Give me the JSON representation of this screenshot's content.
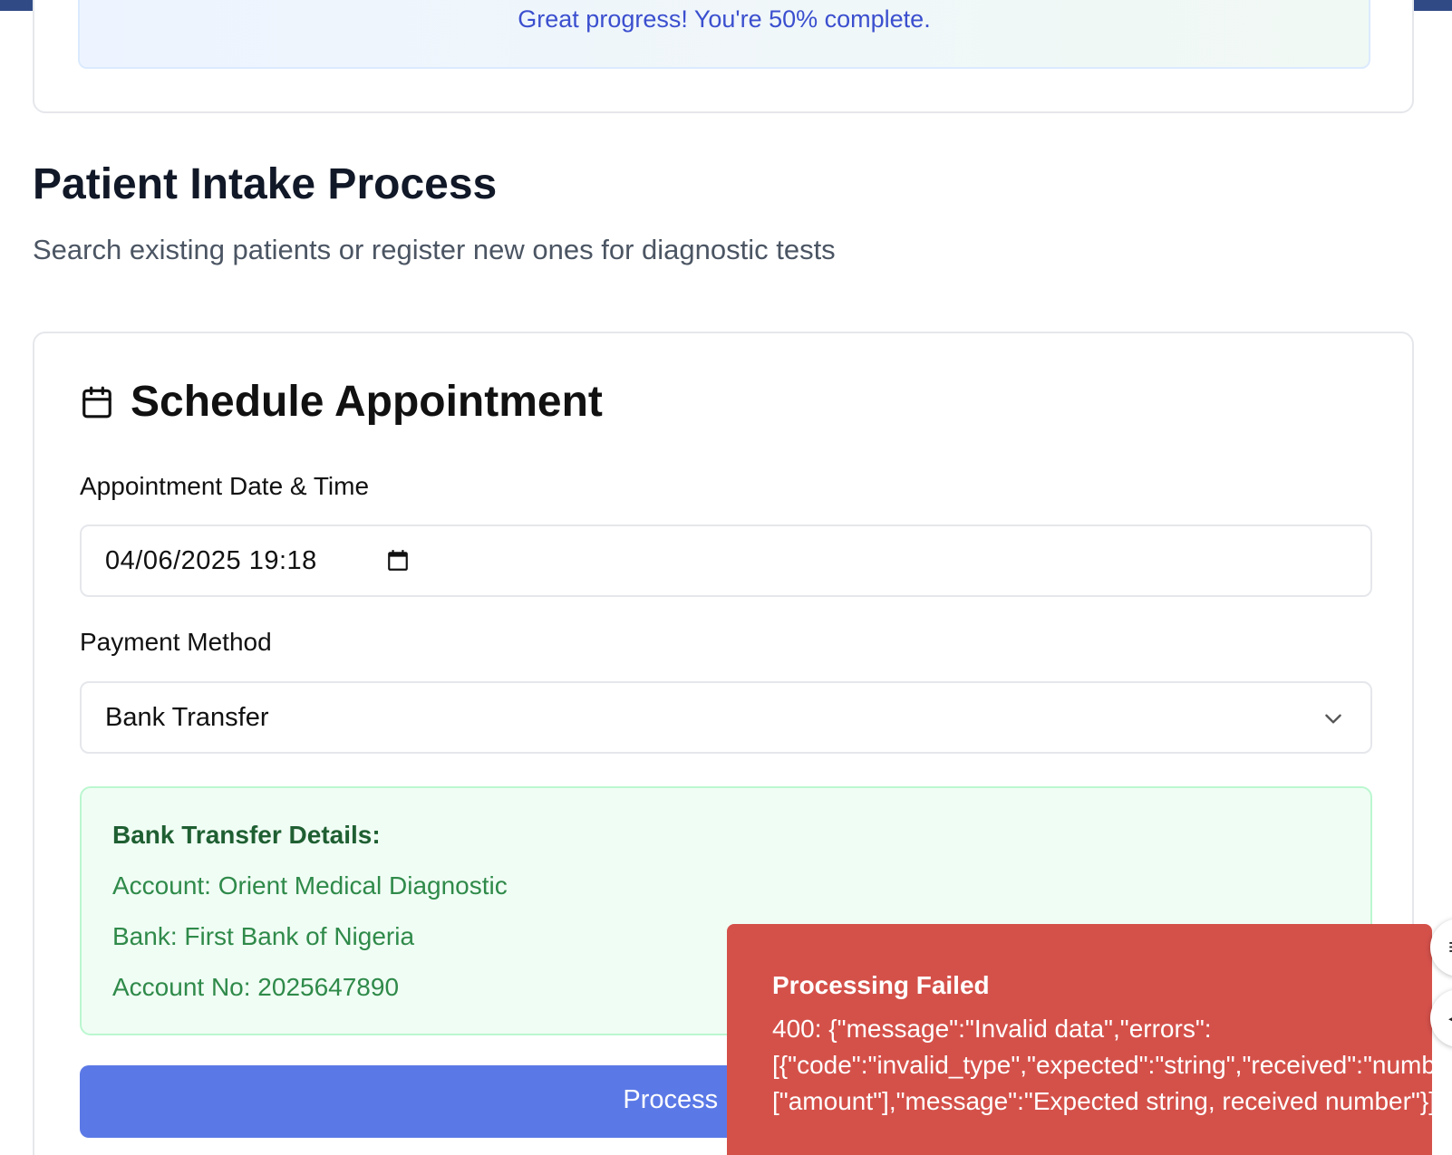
{
  "progress": {
    "message": "Great progress! You're 50% complete.",
    "percent": 50
  },
  "page": {
    "title": "Patient Intake Process",
    "subtitle": "Search existing patients or register new ones for diagnostic tests"
  },
  "appointment": {
    "title": "Schedule Appointment",
    "icon": "calendar-icon",
    "date_label": "Appointment Date & Time",
    "date_value": "04/06/2025  19:18",
    "payment_label": "Payment Method",
    "payment_value": "Bank Transfer"
  },
  "bank_details": {
    "title": "Bank Transfer Details:",
    "account": "Account: Orient Medical Diagnostic",
    "bank": "Bank: First Bank of Nigeria",
    "account_no": "Account No: 2025647890"
  },
  "process_button": {
    "label": "Process Payment"
  },
  "toast": {
    "title": "Processing Failed",
    "line1": "400: {\"message\":\"Invalid data\",\"errors\":",
    "line2": "[{\"code\":\"invalid_type\",\"expected\":\"string\",\"received\":\"number\",\"path\":",
    "line3": "[\"amount\"],\"message\":\"Expected string, received number\"}]}"
  },
  "colors": {
    "accent": "#5b79e6",
    "error": "#d4514a",
    "success_bg": "#f0fdf4",
    "success_text": "#2f8a4a",
    "header_bar": "#2f4a85"
  }
}
